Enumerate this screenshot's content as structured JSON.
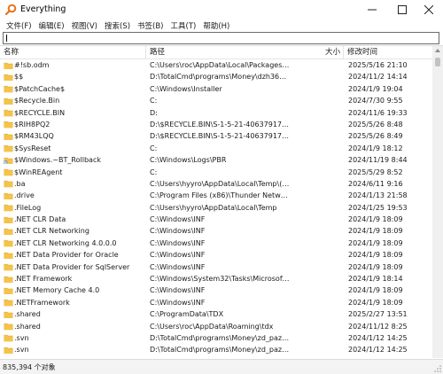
{
  "window": {
    "title": "Everything"
  },
  "menu": [
    {
      "label": "文件(F)"
    },
    {
      "label": "编辑(E)"
    },
    {
      "label": "视图(V)"
    },
    {
      "label": "搜索(S)"
    },
    {
      "label": "书签(B)"
    },
    {
      "label": "工具(T)"
    },
    {
      "label": "帮助(H)"
    }
  ],
  "search": {
    "value": ""
  },
  "columns": {
    "name": "名称",
    "path": "路径",
    "size": "大小",
    "date": "修改时间"
  },
  "rows": [
    {
      "icon": "folder-icon",
      "name": "#!sb.odm",
      "path": "C:\\Users\\roc\\AppData\\Local\\Packages\\...",
      "size": "",
      "date": "2025/5/16 21:10"
    },
    {
      "icon": "folder-icon",
      "name": "$$",
      "path": "D:\\TotalCmd\\programs\\Money\\dzh365\\...",
      "size": "",
      "date": "2024/11/2 14:14"
    },
    {
      "icon": "folder-icon",
      "name": "$PatchCache$",
      "path": "C:\\Windows\\Installer",
      "size": "",
      "date": "2024/1/9 19:04"
    },
    {
      "icon": "folder-icon",
      "name": "$Recycle.Bin",
      "path": "C:",
      "size": "",
      "date": "2024/7/30 9:55"
    },
    {
      "icon": "folder-icon",
      "name": "$RECYCLE.BIN",
      "path": "D:",
      "size": "",
      "date": "2024/11/6 19:33"
    },
    {
      "icon": "folder-icon",
      "name": "$RIH8PQ2",
      "path": "D:\\$RECYCLE.BIN\\S-1-5-21-4063791705-...",
      "size": "",
      "date": "2025/5/26 8:48"
    },
    {
      "icon": "folder-icon",
      "name": "$RM43LQQ",
      "path": "D:\\$RECYCLE.BIN\\S-1-5-21-4063791705-...",
      "size": "",
      "date": "2025/5/26 8:49"
    },
    {
      "icon": "folder-icon",
      "name": "$SysReset",
      "path": "C:",
      "size": "",
      "date": "2024/1/9 18:12"
    },
    {
      "icon": "shortcut-folder-icon",
      "name": "$Windows.~BT_Rollback",
      "path": "C:\\Windows\\Logs\\PBR",
      "size": "",
      "date": "2024/11/19 8:44"
    },
    {
      "icon": "folder-icon",
      "name": "$WinREAgent",
      "path": "C:",
      "size": "",
      "date": "2025/5/29 8:52"
    },
    {
      "icon": "folder-icon",
      "name": ".ba",
      "path": "C:\\Users\\hyyro\\AppData\\Local\\Temp\\(24...",
      "size": "",
      "date": "2024/6/11 9:16"
    },
    {
      "icon": "folder-icon",
      "name": ".drive",
      "path": "C:\\Program Files (x86)\\Thunder Network...",
      "size": "",
      "date": "2024/1/13 21:58"
    },
    {
      "icon": "folder-icon",
      "name": ".FileLog",
      "path": "C:\\Users\\hyyro\\AppData\\Local\\Temp",
      "size": "",
      "date": "2024/1/25 19:53"
    },
    {
      "icon": "folder-icon",
      "name": ".NET CLR Data",
      "path": "C:\\Windows\\INF",
      "size": "",
      "date": "2024/1/9 18:09"
    },
    {
      "icon": "folder-icon",
      "name": ".NET CLR Networking",
      "path": "C:\\Windows\\INF",
      "size": "",
      "date": "2024/1/9 18:09"
    },
    {
      "icon": "folder-icon",
      "name": ".NET CLR Networking 4.0.0.0",
      "path": "C:\\Windows\\INF",
      "size": "",
      "date": "2024/1/9 18:09"
    },
    {
      "icon": "folder-icon",
      "name": ".NET Data Provider for Oracle",
      "path": "C:\\Windows\\INF",
      "size": "",
      "date": "2024/1/9 18:09"
    },
    {
      "icon": "folder-icon",
      "name": ".NET Data Provider for SqlServer",
      "path": "C:\\Windows\\INF",
      "size": "",
      "date": "2024/1/9 18:09"
    },
    {
      "icon": "folder-icon",
      "name": ".NET Framework",
      "path": "C:\\Windows\\System32\\Tasks\\Microsoft\\...",
      "size": "",
      "date": "2024/1/9 18:14"
    },
    {
      "icon": "folder-icon",
      "name": ".NET Memory Cache 4.0",
      "path": "C:\\Windows\\INF",
      "size": "",
      "date": "2024/1/9 18:09"
    },
    {
      "icon": "folder-icon",
      "name": ".NETFramework",
      "path": "C:\\Windows\\INF",
      "size": "",
      "date": "2024/1/9 18:09"
    },
    {
      "icon": "folder-icon",
      "name": ".shared",
      "path": "C:\\ProgramData\\TDX",
      "size": "",
      "date": "2025/2/27 13:51"
    },
    {
      "icon": "folder-icon",
      "name": ".shared",
      "path": "C:\\Users\\roc\\AppData\\Roaming\\tdx",
      "size": "",
      "date": "2024/11/12 8:25"
    },
    {
      "icon": "folder-icon",
      "name": ".svn",
      "path": "D:\\TotalCmd\\programs\\Money\\zd_pazq_...",
      "size": "",
      "date": "2024/1/12 14:25"
    },
    {
      "icon": "folder-icon",
      "name": ".svn",
      "path": "D:\\TotalCmd\\programs\\Money\\zd_pazq_...",
      "size": "",
      "date": "2024/1/12 14:25"
    },
    {
      "icon": "folder-icon",
      "name": ".svn",
      "path": "D:\\TotalCmd\\programs\\Money\\zd_pazq_...",
      "size": "",
      "date": "2024/1/12 14:25"
    }
  ],
  "status": {
    "text": "835,394 个对象"
  },
  "colors": {
    "folder": "#f4c44a",
    "folder_dark": "#e0a92a",
    "app_icon": "#e8731c"
  }
}
